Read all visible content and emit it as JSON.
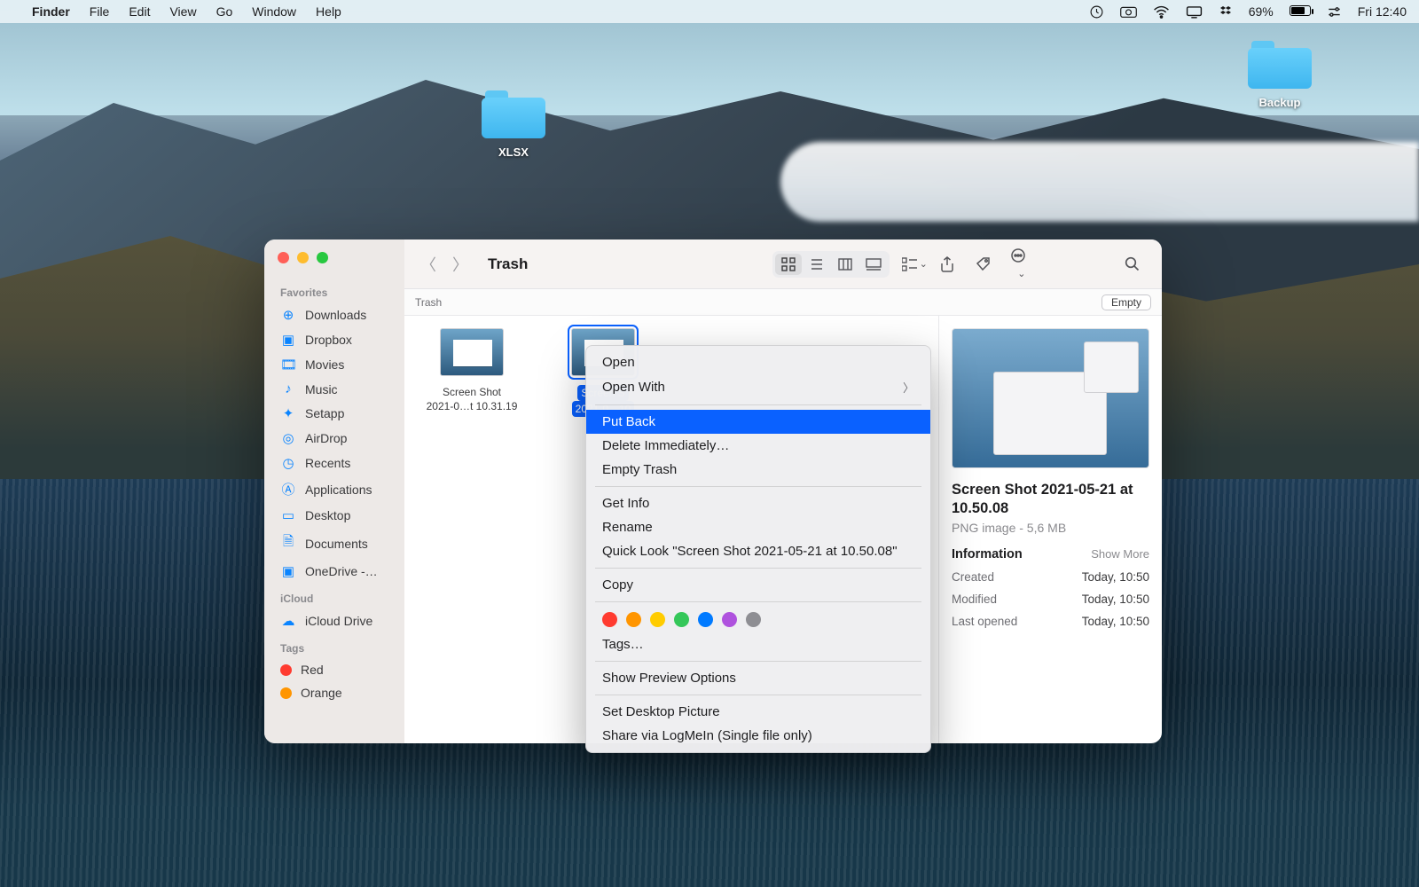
{
  "menubar": {
    "app": "Finder",
    "items": [
      "File",
      "Edit",
      "View",
      "Go",
      "Window",
      "Help"
    ],
    "battery_pct": "69%",
    "clock": "Fri 12:40"
  },
  "desktop_icons": {
    "xlsx": "XLSX",
    "backup": "Backup"
  },
  "finder": {
    "title": "Trash",
    "breadcrumb": "Trash",
    "empty_button": "Empty",
    "sidebar": {
      "favorites_label": "Favorites",
      "items": [
        {
          "icon": "download-icon",
          "label": "Downloads"
        },
        {
          "icon": "folder-icon",
          "label": "Dropbox"
        },
        {
          "icon": "film-icon",
          "label": "Movies"
        },
        {
          "icon": "music-icon",
          "label": "Music"
        },
        {
          "icon": "setapp-icon",
          "label": "Setapp"
        },
        {
          "icon": "airdrop-icon",
          "label": "AirDrop"
        },
        {
          "icon": "clock-icon",
          "label": "Recents"
        },
        {
          "icon": "apps-icon",
          "label": "Applications"
        },
        {
          "icon": "desktop-icon",
          "label": "Desktop"
        },
        {
          "icon": "documents-icon",
          "label": "Documents"
        },
        {
          "icon": "onedrive-icon",
          "label": "OneDrive -…"
        }
      ],
      "icloud_label": "iCloud",
      "icloud_item": "iCloud Drive",
      "tags_label": "Tags",
      "tags": [
        {
          "color": "#ff3b30",
          "label": "Red"
        },
        {
          "color": "#ff9500",
          "label": "Orange"
        }
      ]
    },
    "files": [
      {
        "name1": "Screen Shot",
        "name2": "2021-0…t 10.31.19"
      },
      {
        "name1": "Screen S",
        "name2": "2021-0…10"
      }
    ],
    "preview": {
      "name": "Screen Shot 2021-05-21 at 10.50.08",
      "subtitle": "PNG image - 5,6 MB",
      "info_label": "Information",
      "more_label": "Show More",
      "rows": [
        {
          "k": "Created",
          "v": "Today, 10:50"
        },
        {
          "k": "Modified",
          "v": "Today, 10:50"
        },
        {
          "k": "Last opened",
          "v": "Today, 10:50"
        }
      ]
    }
  },
  "context_menu": {
    "open": "Open",
    "open_with": "Open With",
    "put_back": "Put Back",
    "delete": "Delete Immediately…",
    "empty": "Empty Trash",
    "get_info": "Get Info",
    "rename": "Rename",
    "quick_look": "Quick Look \"Screen Shot 2021-05-21 at 10.50.08\"",
    "copy": "Copy",
    "tags": "Tags…",
    "tag_colors": [
      "#ff3b30",
      "#ff9500",
      "#ffcc00",
      "#34c759",
      "#007aff",
      "#af52de",
      "#8e8e93"
    ],
    "show_preview": "Show Preview Options",
    "set_desktop": "Set Desktop Picture",
    "share": "Share via LogMeIn (Single file only)"
  }
}
